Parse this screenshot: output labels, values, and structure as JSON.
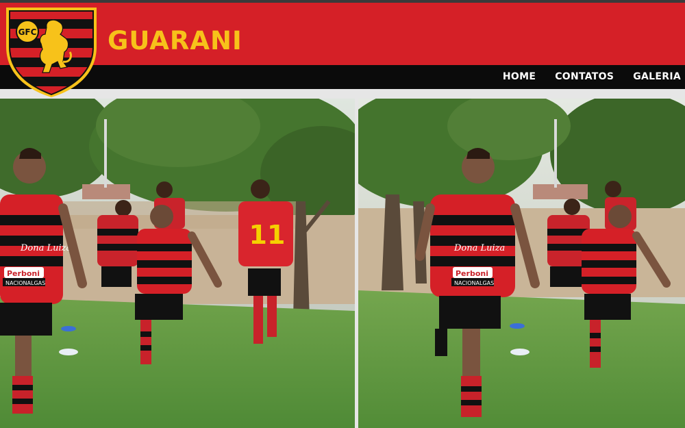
{
  "header": {
    "site_title": "GUARANI",
    "logo": {
      "icon": "club-crest-lion",
      "monogram": "GFC"
    },
    "brand_colors": {
      "red": "#d52027",
      "black": "#0b0b0b",
      "gold": "#f7c21a"
    }
  },
  "nav": {
    "items": [
      {
        "label": "HOME"
      },
      {
        "label": "CONTATOS"
      },
      {
        "label": "GALERIA"
      }
    ]
  },
  "gallery": {
    "photos": [
      {
        "subject": "football-training-photo",
        "jersey_number": "11",
        "sponsor": "Dona Luiza",
        "sponsor2": "Perboni",
        "sponsor3": "NACIONALGAS"
      },
      {
        "subject": "football-training-photo",
        "sponsor": "Dona Luiza",
        "sponsor2": "Perboni",
        "sponsor3": "NACIONALGAS"
      }
    ]
  }
}
